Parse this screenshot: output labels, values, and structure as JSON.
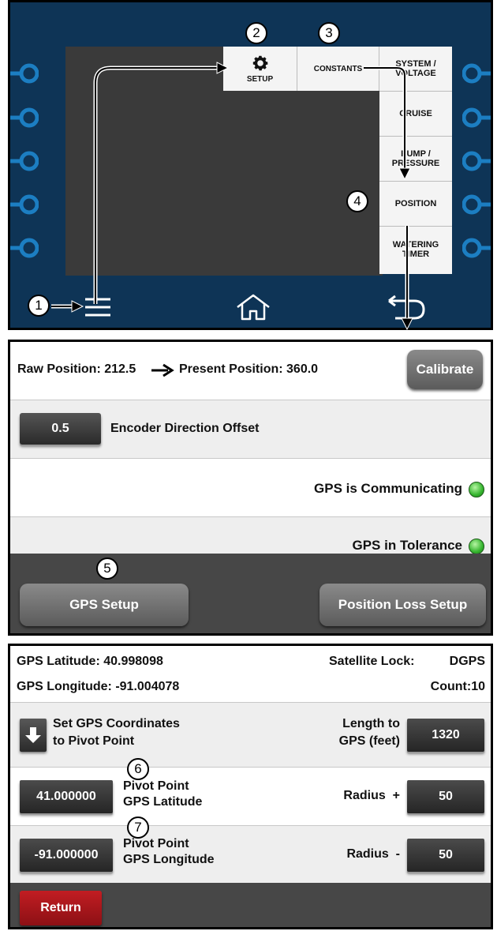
{
  "panel1": {
    "menu_items": [
      "SYSTEM / VOLTAGE",
      "CRUISE",
      "PUMP / PRESSURE",
      "POSITION",
      "WATERING TIMER"
    ],
    "setup_label": "SETUP",
    "constants_label": "CONSTANTS",
    "icons": {
      "setup": "gear-icon",
      "menu": "hamburger-icon",
      "home": "home-icon",
      "back": "return-arrow-icon"
    },
    "callouts": [
      "1",
      "2",
      "3",
      "4"
    ]
  },
  "panel2": {
    "raw_position_label": "Raw Position: 212.5",
    "present_position_label": "Present Position: 360.0",
    "calibrate_label": "Calibrate",
    "encoder_offset_value": "0.5",
    "encoder_offset_label": "Encoder Direction Offset",
    "gps_communicating_label": "GPS is Communicating",
    "gps_tolerance_label": "GPS in Tolerance",
    "gps_setup_label": "GPS Setup",
    "position_loss_label": "Position Loss Setup",
    "callout": "5",
    "colors": {
      "led": "#35b52e"
    }
  },
  "panel3": {
    "gps_latitude": "GPS Latitude: 40.998098",
    "gps_longitude": "GPS Longitude: -91.004078",
    "satellite_lock_label": "Satellite Lock:",
    "satellite_lock_value": "DGPS",
    "count_label": "Count:10",
    "set_coords_line1": "Set GPS Coordinates",
    "set_coords_line2": "to Pivot Point",
    "length_line1": "Length to",
    "length_line2": "GPS (feet)",
    "length_value": "1320",
    "pivot_lat_value": "41.000000",
    "pivot_lat_line1": "Pivot Point",
    "pivot_lat_line2": "GPS Latitude",
    "radius_plus_label": "Radius  +",
    "radius_plus_value": "50",
    "pivot_lon_value": "-91.000000",
    "pivot_lon_line1": "Pivot Point",
    "pivot_lon_line2": "GPS Longitude",
    "radius_minus_label": "Radius  -",
    "radius_minus_value": "50",
    "return_label": "Return",
    "callouts": [
      "6",
      "7"
    ],
    "colors": {
      "return": "#a31419"
    }
  }
}
